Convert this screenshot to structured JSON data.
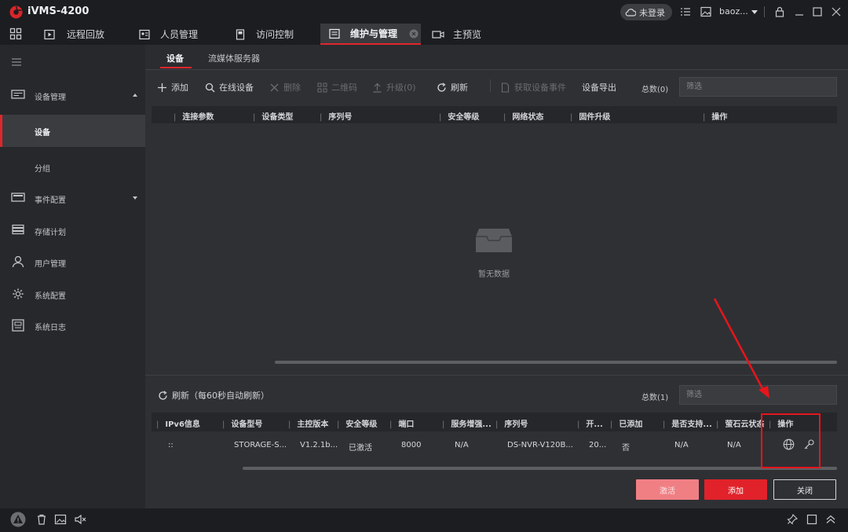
{
  "app": {
    "title": "iVMS-4200",
    "login_status": "未登录",
    "user": "baoz..."
  },
  "tabs": [
    {
      "label": "远程回放",
      "icon": "playback-icon"
    },
    {
      "label": "人员管理",
      "icon": "person-card-icon"
    },
    {
      "label": "访问控制",
      "icon": "door-icon"
    },
    {
      "label": "维护与管理",
      "icon": "maintenance-icon",
      "active": true
    },
    {
      "label": "主预览",
      "icon": "camera-icon"
    }
  ],
  "sidebar": {
    "items": [
      {
        "label": "设备管理",
        "icon": "device-icon",
        "expanded": true
      },
      {
        "label": "设备",
        "selected": true
      },
      {
        "label": "分组"
      },
      {
        "label": "事件配置",
        "icon": "event-icon"
      },
      {
        "label": "存储计划",
        "icon": "storage-icon"
      },
      {
        "label": "用户管理",
        "icon": "user-icon"
      },
      {
        "label": "系统配置",
        "icon": "gear-icon"
      },
      {
        "label": "系统日志",
        "icon": "log-icon"
      }
    ]
  },
  "subtabs": [
    {
      "label": "设备",
      "active": true
    },
    {
      "label": "流媒体服务器"
    }
  ],
  "toolbar": {
    "add": "添加",
    "online": "在线设备",
    "delete": "删除",
    "qrcode": "二维码",
    "upgrade": "升级(0)",
    "refresh": "刷新",
    "events": "获取设备事件",
    "export": "设备导出",
    "total": "总数(0)",
    "filter_placeholder": "筛选"
  },
  "device_table": {
    "columns": [
      "连接参数",
      "设备类型",
      "序列号",
      "安全等级",
      "网络状态",
      "固件升级",
      "操作"
    ],
    "empty_text": "暂无数据"
  },
  "online_section": {
    "refresh_label": "刷新（每60秒自动刷新）",
    "total": "总数(1)",
    "filter_placeholder": "筛选",
    "columns": [
      "IPv6信息",
      "设备型号",
      "主控版本",
      "安全等级",
      "端口",
      "服务增强...",
      "序列号",
      "开...",
      "已添加",
      "是否支持...",
      "萤石云状态",
      "操作"
    ],
    "rows": [
      {
        "ipv6": "::",
        "model": "STORAGE-S...",
        "version": "V1.2.1b...",
        "security": "已激活",
        "port": "8000",
        "enhance": "N/A",
        "serial": "DS-NVR-V120B...",
        "start": "20...",
        "added": "否",
        "support": "N/A",
        "ezviz": "N/A"
      }
    ]
  },
  "buttons": {
    "activate": "激活",
    "add": "添加",
    "close": "关闭"
  },
  "colors": {
    "accent": "#e0262b",
    "annotation": "#e8151b"
  }
}
